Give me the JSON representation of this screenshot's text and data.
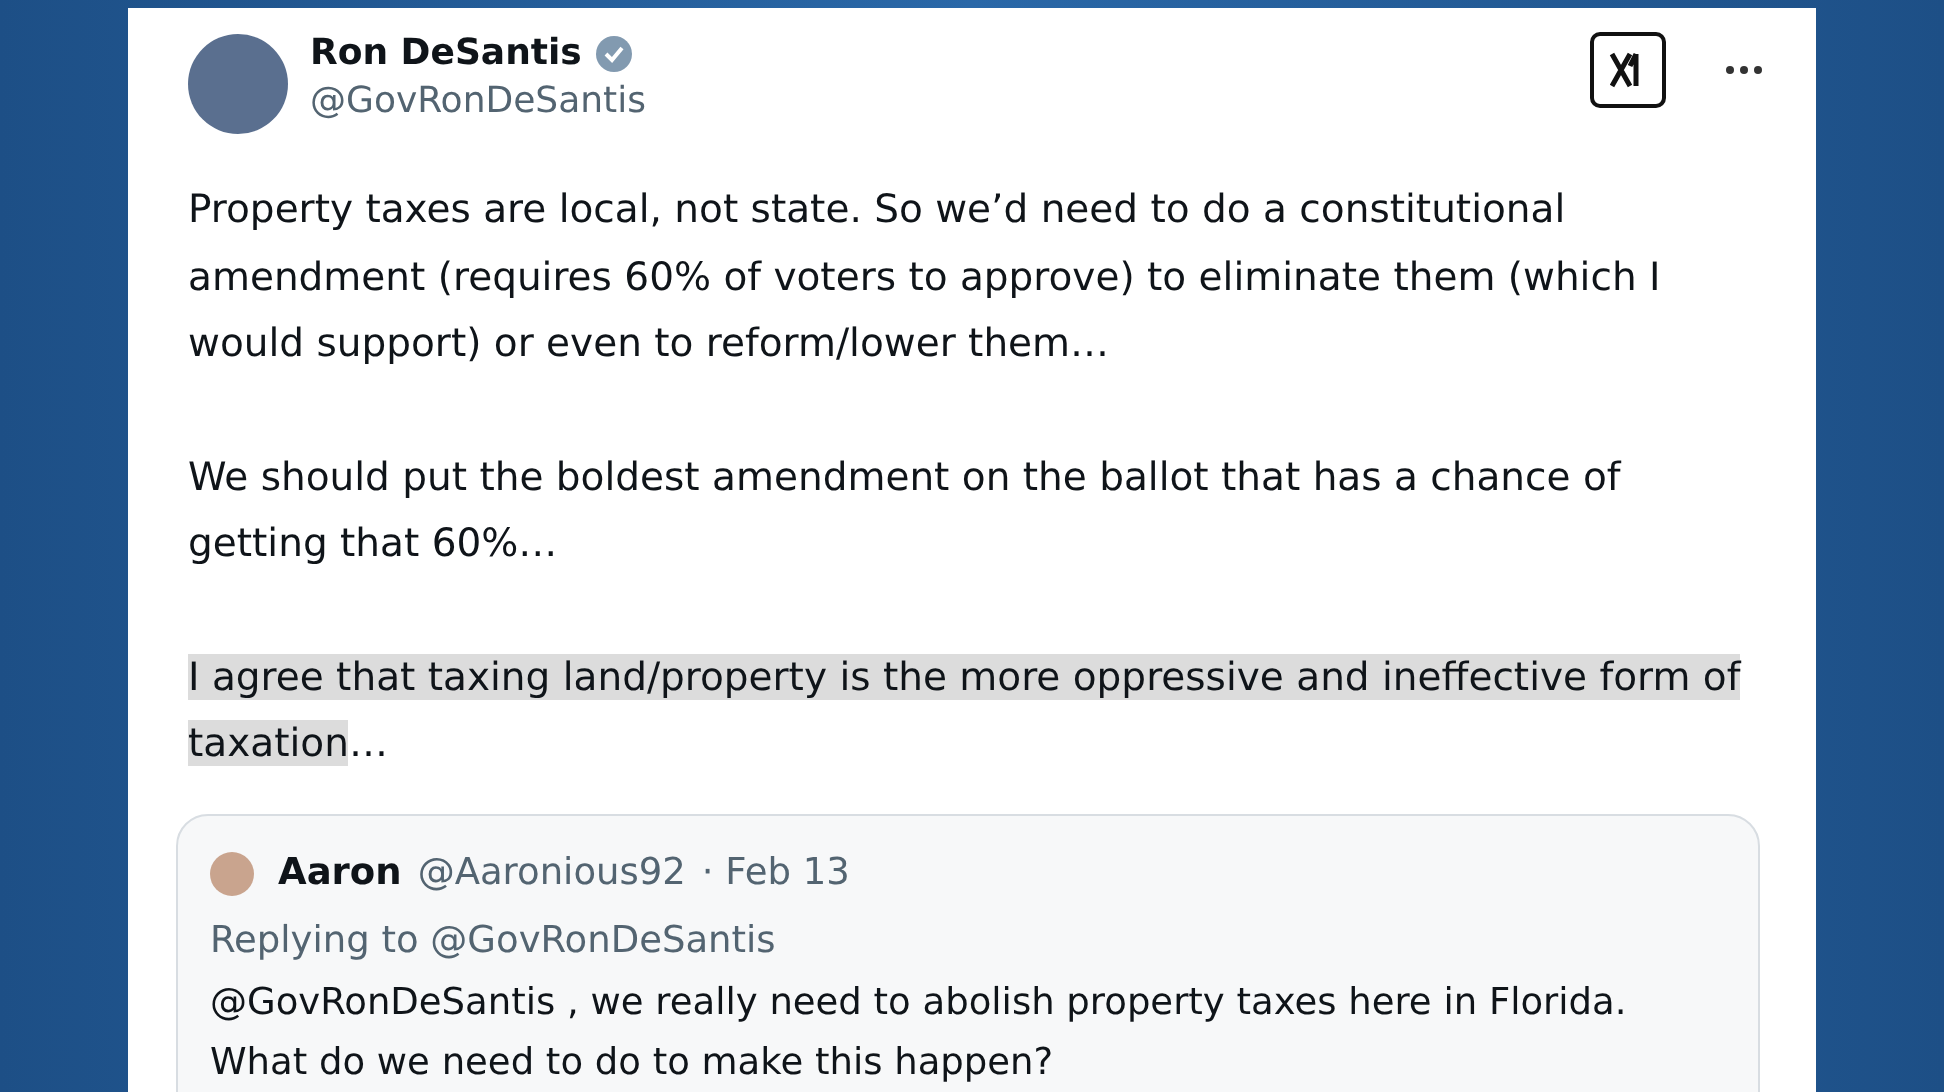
{
  "post": {
    "author": {
      "name": "Ron DeSantis",
      "handle": "@GovRonDeSantis",
      "verified": true
    },
    "paragraphs": [
      {
        "segments": [
          {
            "text": "Property taxes are local, not state.  So we’d need to do a constitutional amendment (requires 60% of voters to approve) to eliminate them (which I would support) or even to reform/lower them…",
            "highlighted": false
          }
        ]
      },
      {
        "segments": [
          {
            "text": "We should put the boldest amendment on the ballot that has a chance of getting that 60%…",
            "highlighted": false
          }
        ]
      },
      {
        "segments": [
          {
            "text": "I agree that taxing land/property is the more oppressive and ineffective form of taxation",
            "highlighted": true
          },
          {
            "text": "…",
            "highlighted": false
          }
        ]
      }
    ],
    "quote": {
      "name": "Aaron",
      "handle": "@Aaronious92",
      "date": "· Feb 13",
      "replying_to": "Replying to @GovRonDeSantis",
      "text": "@GovRonDeSantis , we really need to abolish property taxes here in Florida. What do we need to do to make this happen?"
    }
  }
}
